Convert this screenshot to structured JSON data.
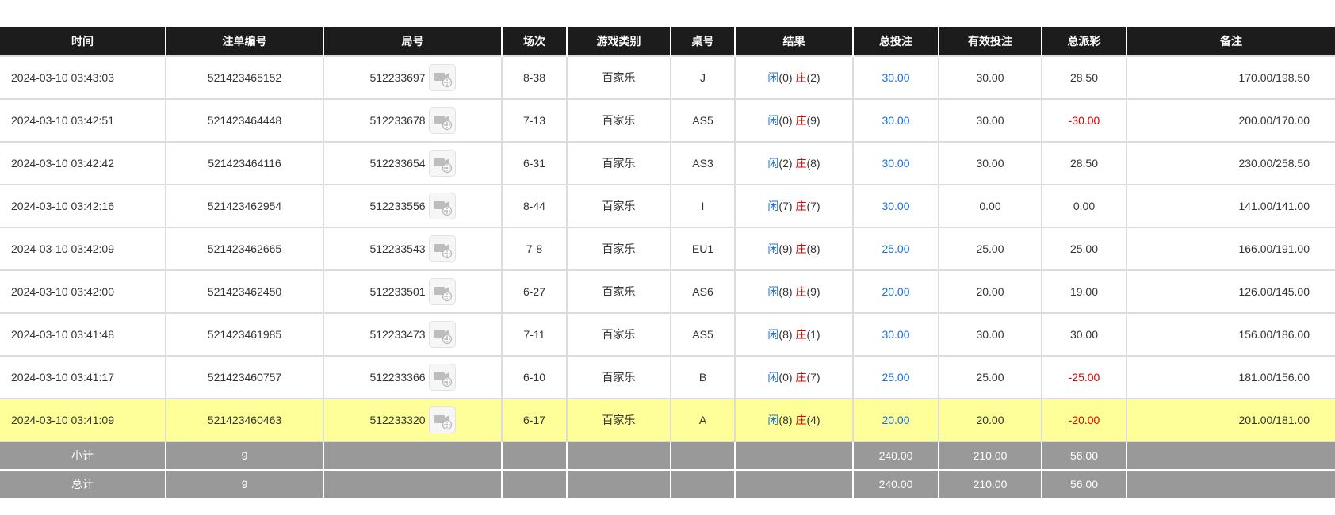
{
  "columns": [
    "时间",
    "注单编号",
    "局号",
    "场次",
    "游戏类别",
    "桌号",
    "结果",
    "总投注",
    "有效投注",
    "总派彩",
    "备注"
  ],
  "rows": [
    {
      "time": "2024-03-10 03:43:03",
      "bet_id": "521423465152",
      "round": "512233697",
      "shoe": "8-38",
      "game": "百家乐",
      "table": "J",
      "player_label": "闲",
      "player_score": "(0)",
      "banker_label": "庄",
      "banker_score": "(2)",
      "total_bet": "30.00",
      "valid_bet": "30.00",
      "payout": "28.50",
      "payout_negative": false,
      "remark": "170.00/198.50",
      "highlight": false
    },
    {
      "time": "2024-03-10 03:42:51",
      "bet_id": "521423464448",
      "round": "512233678",
      "shoe": "7-13",
      "game": "百家乐",
      "table": "AS5",
      "player_label": "闲",
      "player_score": "(0)",
      "banker_label": "庄",
      "banker_score": "(9)",
      "total_bet": "30.00",
      "valid_bet": "30.00",
      "payout": "-30.00",
      "payout_negative": true,
      "remark": "200.00/170.00",
      "highlight": false
    },
    {
      "time": "2024-03-10 03:42:42",
      "bet_id": "521423464116",
      "round": "512233654",
      "shoe": "6-31",
      "game": "百家乐",
      "table": "AS3",
      "player_label": "闲",
      "player_score": "(2)",
      "banker_label": "庄",
      "banker_score": "(8)",
      "total_bet": "30.00",
      "valid_bet": "30.00",
      "payout": "28.50",
      "payout_negative": false,
      "remark": "230.00/258.50",
      "highlight": false
    },
    {
      "time": "2024-03-10 03:42:16",
      "bet_id": "521423462954",
      "round": "512233556",
      "shoe": "8-44",
      "game": "百家乐",
      "table": "I",
      "player_label": "闲",
      "player_score": "(7)",
      "banker_label": "庄",
      "banker_score": "(7)",
      "total_bet": "30.00",
      "valid_bet": "0.00",
      "payout": "0.00",
      "payout_negative": false,
      "remark": "141.00/141.00",
      "highlight": false
    },
    {
      "time": "2024-03-10 03:42:09",
      "bet_id": "521423462665",
      "round": "512233543",
      "shoe": "7-8",
      "game": "百家乐",
      "table": "EU1",
      "player_label": "闲",
      "player_score": "(9)",
      "banker_label": "庄",
      "banker_score": "(8)",
      "total_bet": "25.00",
      "valid_bet": "25.00",
      "payout": "25.00",
      "payout_negative": false,
      "remark": "166.00/191.00",
      "highlight": false
    },
    {
      "time": "2024-03-10 03:42:00",
      "bet_id": "521423462450",
      "round": "512233501",
      "shoe": "6-27",
      "game": "百家乐",
      "table": "AS6",
      "player_label": "闲",
      "player_score": "(8)",
      "banker_label": "庄",
      "banker_score": "(9)",
      "total_bet": "20.00",
      "valid_bet": "20.00",
      "payout": "19.00",
      "payout_negative": false,
      "remark": "126.00/145.00",
      "highlight": false
    },
    {
      "time": "2024-03-10 03:41:48",
      "bet_id": "521423461985",
      "round": "512233473",
      "shoe": "7-11",
      "game": "百家乐",
      "table": "AS5",
      "player_label": "闲",
      "player_score": "(8)",
      "banker_label": "庄",
      "banker_score": "(1)",
      "total_bet": "30.00",
      "valid_bet": "30.00",
      "payout": "30.00",
      "payout_negative": false,
      "remark": "156.00/186.00",
      "highlight": false
    },
    {
      "time": "2024-03-10 03:41:17",
      "bet_id": "521423460757",
      "round": "512233366",
      "shoe": "6-10",
      "game": "百家乐",
      "table": "B",
      "player_label": "闲",
      "player_score": "(0)",
      "banker_label": "庄",
      "banker_score": "(7)",
      "total_bet": "25.00",
      "valid_bet": "25.00",
      "payout": "-25.00",
      "payout_negative": true,
      "remark": "181.00/156.00",
      "highlight": false
    },
    {
      "time": "2024-03-10 03:41:09",
      "bet_id": "521423460463",
      "round": "512233320",
      "shoe": "6-17",
      "game": "百家乐",
      "table": "A",
      "player_label": "闲",
      "player_score": "(8)",
      "banker_label": "庄",
      "banker_score": "(4)",
      "total_bet": "20.00",
      "valid_bet": "20.00",
      "payout": "-20.00",
      "payout_negative": true,
      "remark": "201.00/181.00",
      "highlight": true
    }
  ],
  "summary": [
    {
      "label": "小计",
      "count": "9",
      "total_bet": "240.00",
      "valid_bet": "210.00",
      "payout": "56.00"
    },
    {
      "label": "总计",
      "count": "9",
      "total_bet": "240.00",
      "valid_bet": "210.00",
      "payout": "56.00"
    }
  ],
  "icons": {
    "replay": "video-replay-icon"
  },
  "colors": {
    "header_bg": "#1c1c1c",
    "highlight_row": "#ffff99",
    "summary_bg": "#999999",
    "player": "#1a6fe0",
    "banker": "#e00000",
    "negative": "#e00000",
    "total_bet": "#1a6fe0"
  }
}
